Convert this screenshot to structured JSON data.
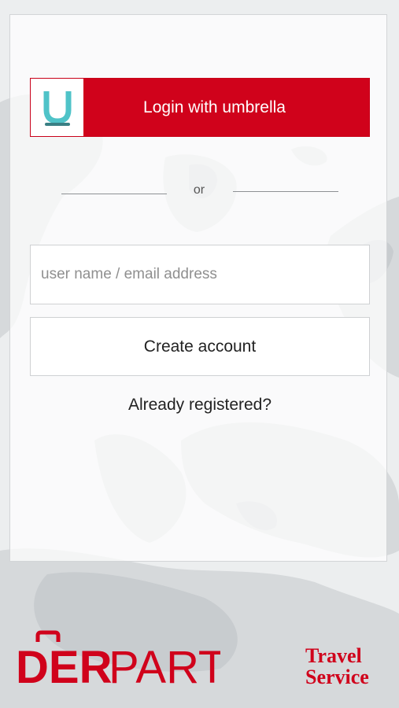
{
  "login": {
    "umbrella_button_label": "Login with umbrella",
    "umbrella_logo_letter": "U",
    "divider_text": "or",
    "username_placeholder": "user name / email address",
    "create_account_label": "Create account",
    "already_registered_label": "Already registered?"
  },
  "branding": {
    "logo_part1": "DER",
    "logo_part2": "PART",
    "tagline_line1": "Travel",
    "tagline_line2": "Service"
  },
  "colors": {
    "brand_red": "#d0021b",
    "umbrella_teal": "#4fc3c8"
  },
  "icons": {
    "umbrella_logo": "umbrella-u-icon",
    "luggage": "luggage-icon"
  }
}
